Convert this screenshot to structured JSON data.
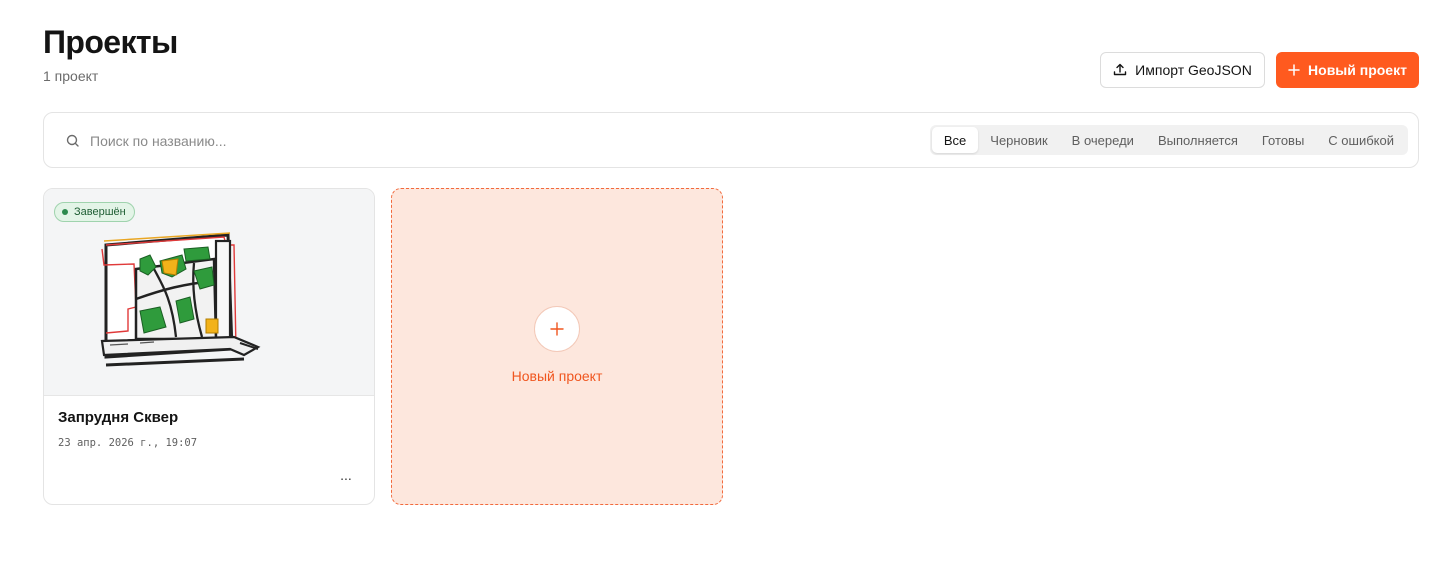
{
  "header": {
    "title": "Проекты",
    "subtitle": "1 проект",
    "import_label": "Импорт GeoJSON",
    "new_project_label": "Новый проект"
  },
  "search": {
    "placeholder": "Поиск по названию..."
  },
  "filters": [
    {
      "label": "Все",
      "active": true
    },
    {
      "label": "Черновик",
      "active": false
    },
    {
      "label": "В очереди",
      "active": false
    },
    {
      "label": "Выполняется",
      "active": false
    },
    {
      "label": "Готовы",
      "active": false
    },
    {
      "label": "С ошибкой",
      "active": false
    }
  ],
  "projects": [
    {
      "status": "Завершён",
      "title": "Запрудня Сквер",
      "date": "23 апр. 2026 г., 19:07",
      "menu": "..."
    }
  ],
  "new_card": {
    "label": "Новый проект"
  },
  "colors": {
    "accent": "#ff5a1f",
    "new_card_bg": "#fde7dd",
    "status_done": "#2d8a4e"
  },
  "icons": {
    "import": "upload-icon",
    "new": "plus-icon",
    "search": "search-icon",
    "menu": "more-icon"
  }
}
